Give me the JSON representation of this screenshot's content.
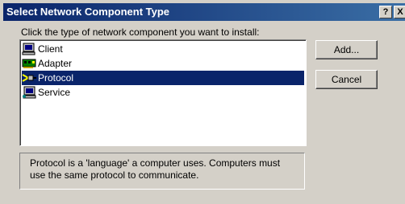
{
  "window": {
    "title": "Select Network Component Type",
    "help_label": "?",
    "close_label": "X"
  },
  "instruction": "Click the type of network component you want to install:",
  "components": {
    "items": [
      {
        "label": "Client",
        "icon": "client-computer-icon",
        "selected": false
      },
      {
        "label": "Adapter",
        "icon": "network-adapter-icon",
        "selected": false
      },
      {
        "label": "Protocol",
        "icon": "protocol-cable-icon",
        "selected": true
      },
      {
        "label": "Service",
        "icon": "service-computer-icon",
        "selected": false
      }
    ]
  },
  "buttons": {
    "add_label": "Add...",
    "cancel_label": "Cancel"
  },
  "description": "Protocol is a 'language' a computer uses. Computers must use the same protocol to communicate.",
  "colors": {
    "title_active": "#0a246a",
    "dialog_face": "#d4d0c8",
    "selection": "#0a246a"
  }
}
